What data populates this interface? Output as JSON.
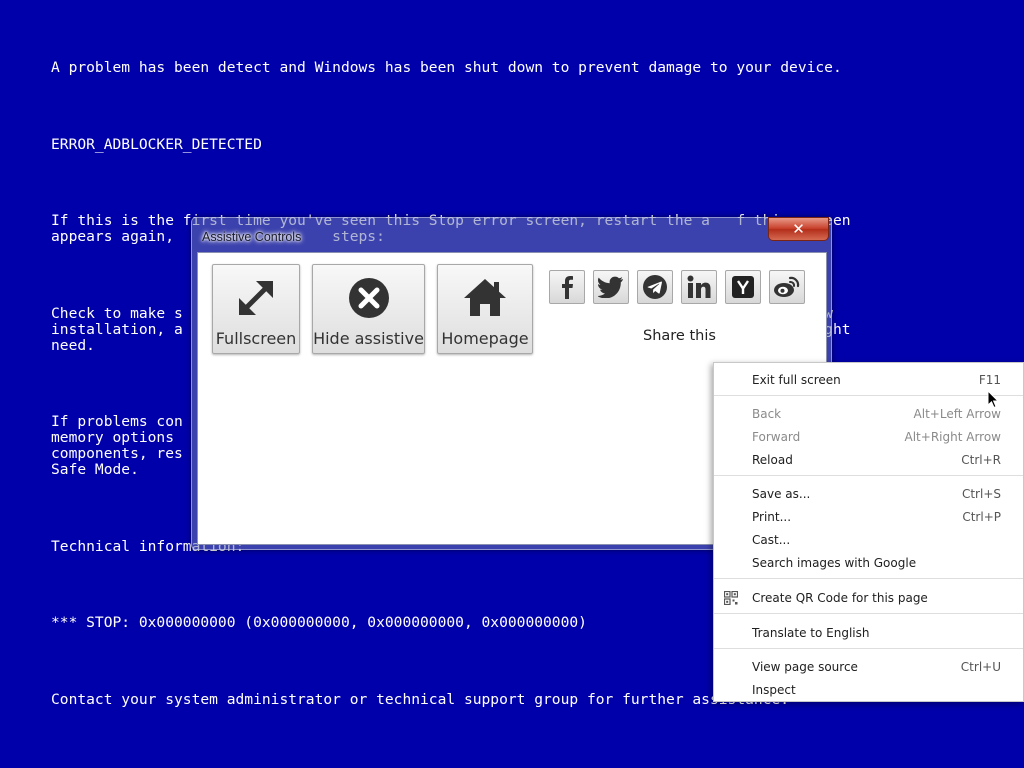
{
  "bsod": {
    "line1": "A problem has been detect and Windows has been shut down to prevent damage to your device.",
    "line2": "ERROR_ADBLOCKER_DETECTED",
    "line3a": "If this is the first time you've seen this Stop error screen, restart the a   f this screen",
    "line3b": "appears again,                  steps:",
    "line4a": "Check to make s                                                                   s a new",
    "line4b": "installation, a                                                                   you might",
    "line4c": "need.",
    "line5a": "If problems con",
    "line5b": "memory options",
    "line5c": "components, res",
    "line5d": "Safe Mode.",
    "line6": "Technical information:",
    "line7": "*** STOP: 0x000000000 (0x000000000, 0x000000000, 0x000000000)",
    "line8": "Contact your system administrator or technical support group for further assistance."
  },
  "dialog": {
    "title": "Assistive Controls",
    "close": "✕",
    "buttons": {
      "fullscreen": "Fullscreen",
      "hide": "Hide assistive",
      "homepage": "Homepage"
    },
    "share_label": "Share this"
  },
  "context_menu": {
    "exit_full_screen": {
      "label": "Exit full screen",
      "key": "F11"
    },
    "back": {
      "label": "Back",
      "key": "Alt+Left Arrow"
    },
    "forward": {
      "label": "Forward",
      "key": "Alt+Right Arrow"
    },
    "reload": {
      "label": "Reload",
      "key": "Ctrl+R"
    },
    "save_as": {
      "label": "Save as...",
      "key": "Ctrl+S"
    },
    "print": {
      "label": "Print...",
      "key": "Ctrl+P"
    },
    "cast": {
      "label": "Cast..."
    },
    "search_images": {
      "label": "Search images with Google"
    },
    "qr_code": {
      "label": "Create QR Code for this page"
    },
    "translate": {
      "label": "Translate to English"
    },
    "view_source": {
      "label": "View page source",
      "key": "Ctrl+U"
    },
    "inspect": {
      "label": "Inspect"
    }
  },
  "colors": {
    "background": "#0000aa",
    "close_red": "#c8402a",
    "telegram_blue": "#2a2a2a"
  }
}
